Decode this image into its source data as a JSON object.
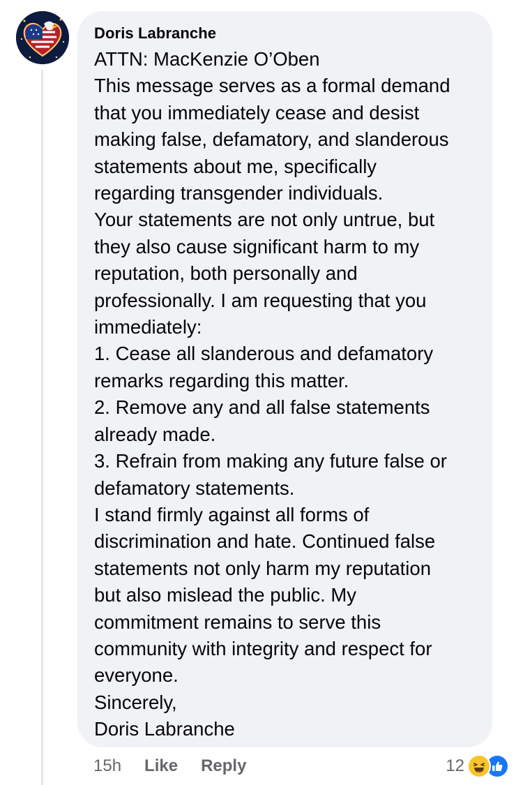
{
  "comment": {
    "author": "Doris Labranche",
    "avatar_icon": "heart-flag-avatar-icon",
    "lines": [
      "ATTN:  MacKenzie O’Oben",
      "This message serves as a formal demand",
      "that you immediately cease and desist",
      "making false, defamatory, and slanderous",
      "statements about me, specifically",
      "regarding transgender individuals.",
      "Your statements are not only untrue, but",
      "they also cause significant harm to my",
      "reputation, both personally and",
      "professionally. I am requesting that you",
      "immediately:",
      "1. Cease all slanderous and defamatory",
      "remarks regarding this matter.",
      "2. Remove any and all false statements",
      "already made.",
      "3. Refrain from making any future false or",
      "defamatory statements.",
      "I stand firmly against all forms of",
      "discrimination and hate. Continued false",
      "statements not only harm my reputation",
      "but also mislead the public.  My",
      "commitment remains to serve this",
      "community with integrity and respect for",
      "everyone.",
      "Sincerely,",
      "Doris Labranche"
    ]
  },
  "actions": {
    "time": "15h",
    "like_label": "Like",
    "reply_label": "Reply"
  },
  "reactions": {
    "count": "12",
    "icons": [
      "haha-reaction-icon",
      "like-reaction-icon"
    ]
  },
  "colors": {
    "bubble": "#f0f2f5",
    "text": "#050505",
    "secondary": "#65676b",
    "like_blue": "#1877f2",
    "haha_yellow": "#f7c52b"
  }
}
